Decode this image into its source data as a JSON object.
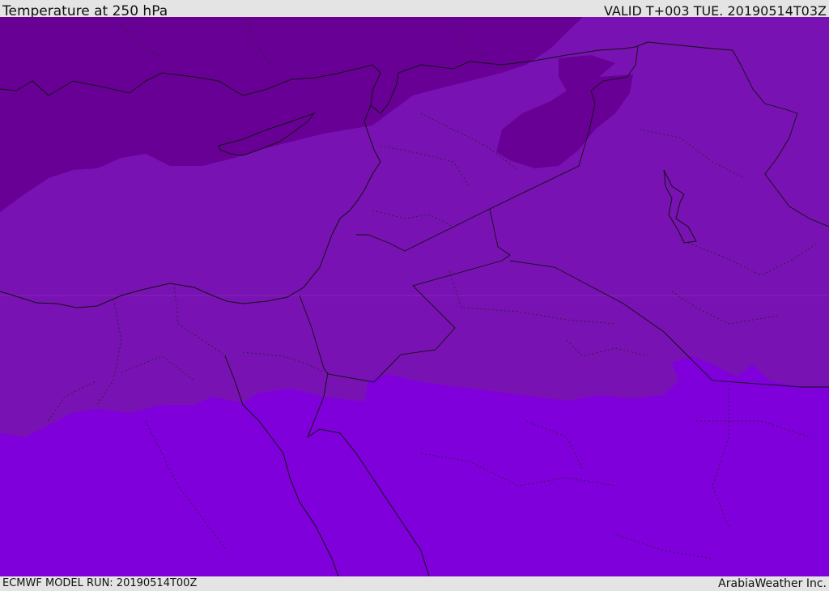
{
  "header": {
    "title": "Temperature at 250 hPa",
    "valid": "VALID T+003 TUE. 20190514T03Z"
  },
  "footer": {
    "model_run": "ECMWF MODEL RUN: 20190514T00Z",
    "brand": "ArabiaWeather Inc."
  },
  "colors": {
    "band_dark": "#690096",
    "band_mid": "#7912b2",
    "band_light": "#7f00db",
    "coastline": "#111111"
  }
}
